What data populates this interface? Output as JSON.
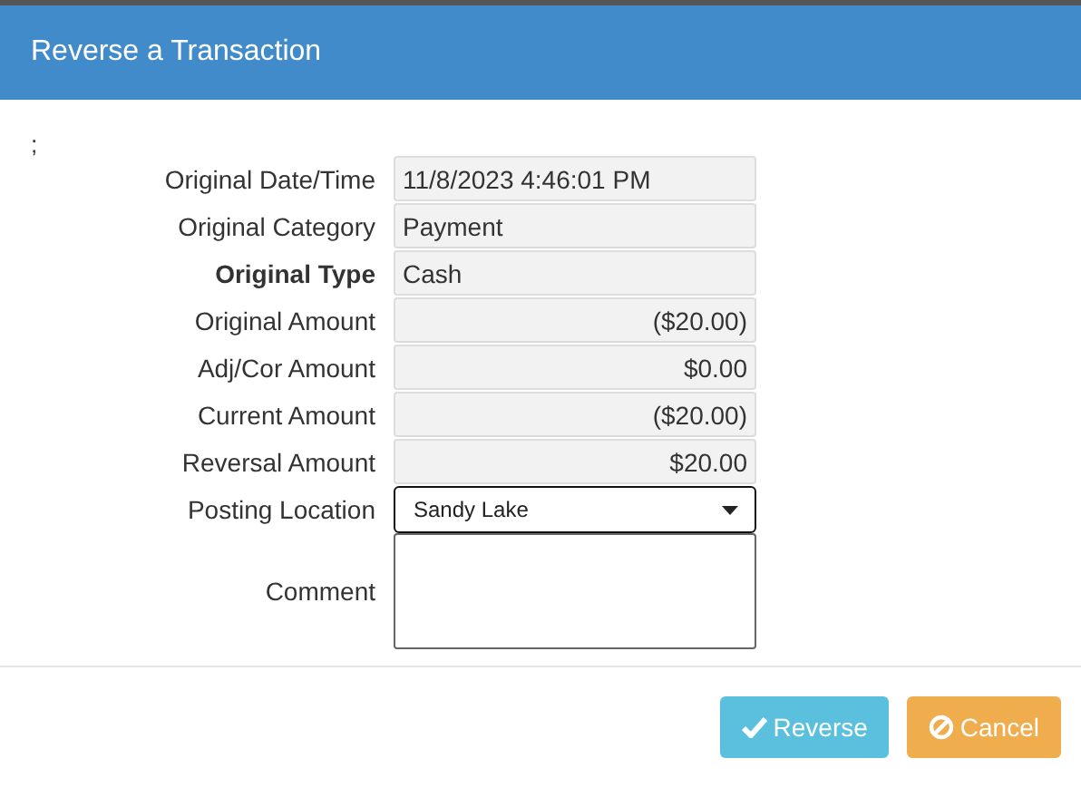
{
  "dialog": {
    "title": "Reverse a Transaction",
    "note": ";",
    "fields": [
      {
        "label": "Original Date/Time",
        "kind": "text",
        "value": "11/8/2023 4:46:01 PM",
        "bold": false
      },
      {
        "label": "Original Category",
        "kind": "text",
        "value": "Payment",
        "bold": false
      },
      {
        "label": "Original Type",
        "kind": "text",
        "value": "Cash",
        "bold": true
      },
      {
        "label": "Original Amount",
        "kind": "amount",
        "value": "($20.00)",
        "bold": false
      },
      {
        "label": "Adj/Cor Amount",
        "kind": "amount",
        "value": "$0.00",
        "bold": false
      },
      {
        "label": "Current Amount",
        "kind": "amount",
        "value": "($20.00)",
        "bold": false
      },
      {
        "label": "Reversal Amount",
        "kind": "amount",
        "value": "$20.00",
        "bold": false
      },
      {
        "label": "Posting Location",
        "kind": "select",
        "value": "Sandy Lake",
        "bold": false
      },
      {
        "label": "Comment",
        "kind": "textarea",
        "bold": false
      }
    ],
    "buttons": [
      {
        "label": "Reverse",
        "kind": "primary"
      },
      {
        "label": "Cancel",
        "kind": "cancel"
      }
    ]
  }
}
